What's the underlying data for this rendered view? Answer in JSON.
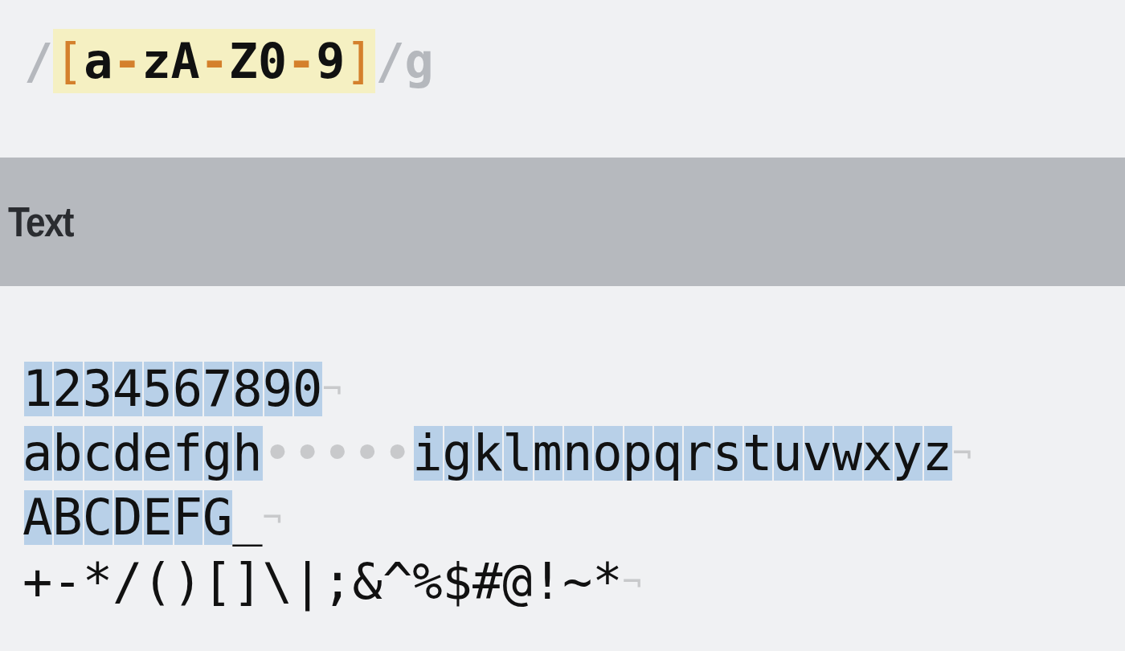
{
  "expression": {
    "open": "/",
    "tokens": [
      {
        "text": "[",
        "kind": "bracket"
      },
      {
        "text": "a",
        "kind": "char"
      },
      {
        "text": "-",
        "kind": "range"
      },
      {
        "text": "z",
        "kind": "char"
      },
      {
        "text": "A",
        "kind": "char"
      },
      {
        "text": "-",
        "kind": "range"
      },
      {
        "text": "Z",
        "kind": "char"
      },
      {
        "text": "0",
        "kind": "char"
      },
      {
        "text": "-",
        "kind": "range"
      },
      {
        "text": "9",
        "kind": "char"
      },
      {
        "text": "]",
        "kind": "bracket"
      }
    ],
    "close": "/",
    "flags": "g"
  },
  "section": {
    "title": "Text"
  },
  "lines": [
    {
      "segments": [
        {
          "text": "1234567890",
          "kind": "match"
        },
        {
          "text": "¬",
          "kind": "eol"
        }
      ]
    },
    {
      "segments": [
        {
          "text": "abcdefgh",
          "kind": "match"
        },
        {
          "text": "•••••",
          "kind": "whitespace"
        },
        {
          "text": "igklmnopqrstuvwxyz",
          "kind": "match"
        },
        {
          "text": "¬",
          "kind": "eol"
        }
      ]
    },
    {
      "segments": [
        {
          "text": "ABCDEFG",
          "kind": "match"
        },
        {
          "text": "_",
          "kind": "plain"
        },
        {
          "text": "¬",
          "kind": "eol"
        }
      ]
    },
    {
      "segments": [
        {
          "text": "+-*/()[]\\|;&^%$#@!~*",
          "kind": "plain"
        },
        {
          "text": "¬",
          "kind": "eol"
        }
      ]
    }
  ]
}
